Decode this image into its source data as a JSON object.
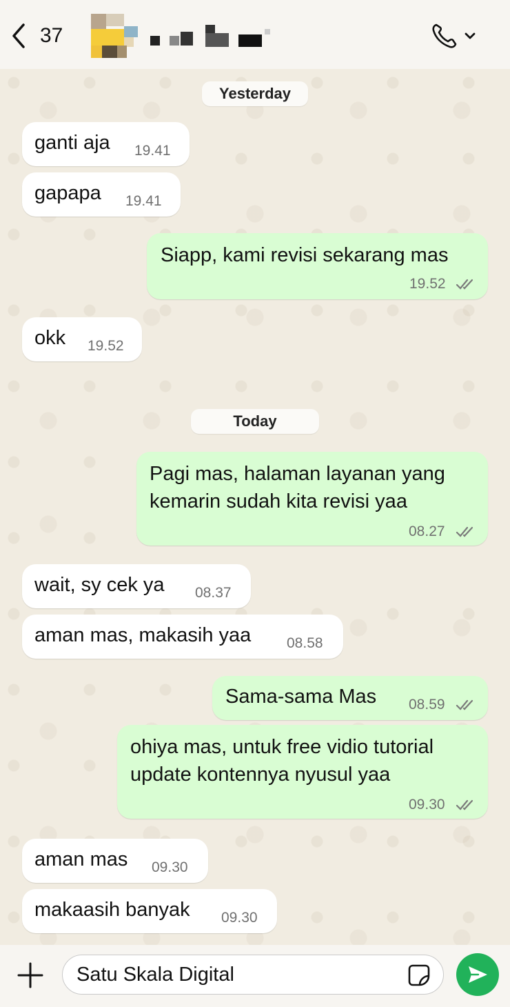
{
  "header": {
    "back_count": "37",
    "contact_name": "",
    "call_icon": "phone-icon",
    "chevron_icon": "chevron-down-icon"
  },
  "dates": {
    "yesterday": "Yesterday",
    "today": "Today"
  },
  "messages": [
    {
      "direction": "in",
      "text": "ganti aja",
      "time": "19.41"
    },
    {
      "direction": "in",
      "text": "gapapa",
      "time": "19.41"
    },
    {
      "direction": "out",
      "text": "Siapp, kami revisi sekarang mas",
      "time": "19.52",
      "status": "read"
    },
    {
      "direction": "in",
      "text": "okk",
      "time": "19.52"
    },
    {
      "direction": "out",
      "text_lines": [
        "Pagi mas, halaman layanan yang",
        "kemarin sudah kita revisi yaa"
      ],
      "time": "08.27",
      "status": "read"
    },
    {
      "direction": "in",
      "text": "wait, sy cek ya",
      "time": "08.37"
    },
    {
      "direction": "in",
      "text": "aman mas, makasih yaa",
      "time": "08.58"
    },
    {
      "direction": "out",
      "text": "Sama-sama Mas",
      "time": "08.59",
      "status": "read"
    },
    {
      "direction": "out",
      "text_lines": [
        "ohiya mas, untuk free vidio tutorial",
        "update kontennya nyusul yaa"
      ],
      "time": "09.30",
      "status": "read"
    },
    {
      "direction": "in",
      "text": "aman mas",
      "time": "09.30"
    },
    {
      "direction": "in",
      "text": "makaasih banyak",
      "time": "09.30"
    }
  ],
  "composer": {
    "value": "Satu Skala Digital",
    "sticker_icon": "sticker-icon",
    "send_icon": "send-icon",
    "plus_icon": "plus-icon"
  },
  "colors": {
    "incoming_bubble": "#ffffff",
    "outgoing_bubble": "#d9fdd3",
    "chat_background": "#f1ece1",
    "read_ticks": "#7a7a7a",
    "send_button": "#21b25a"
  }
}
